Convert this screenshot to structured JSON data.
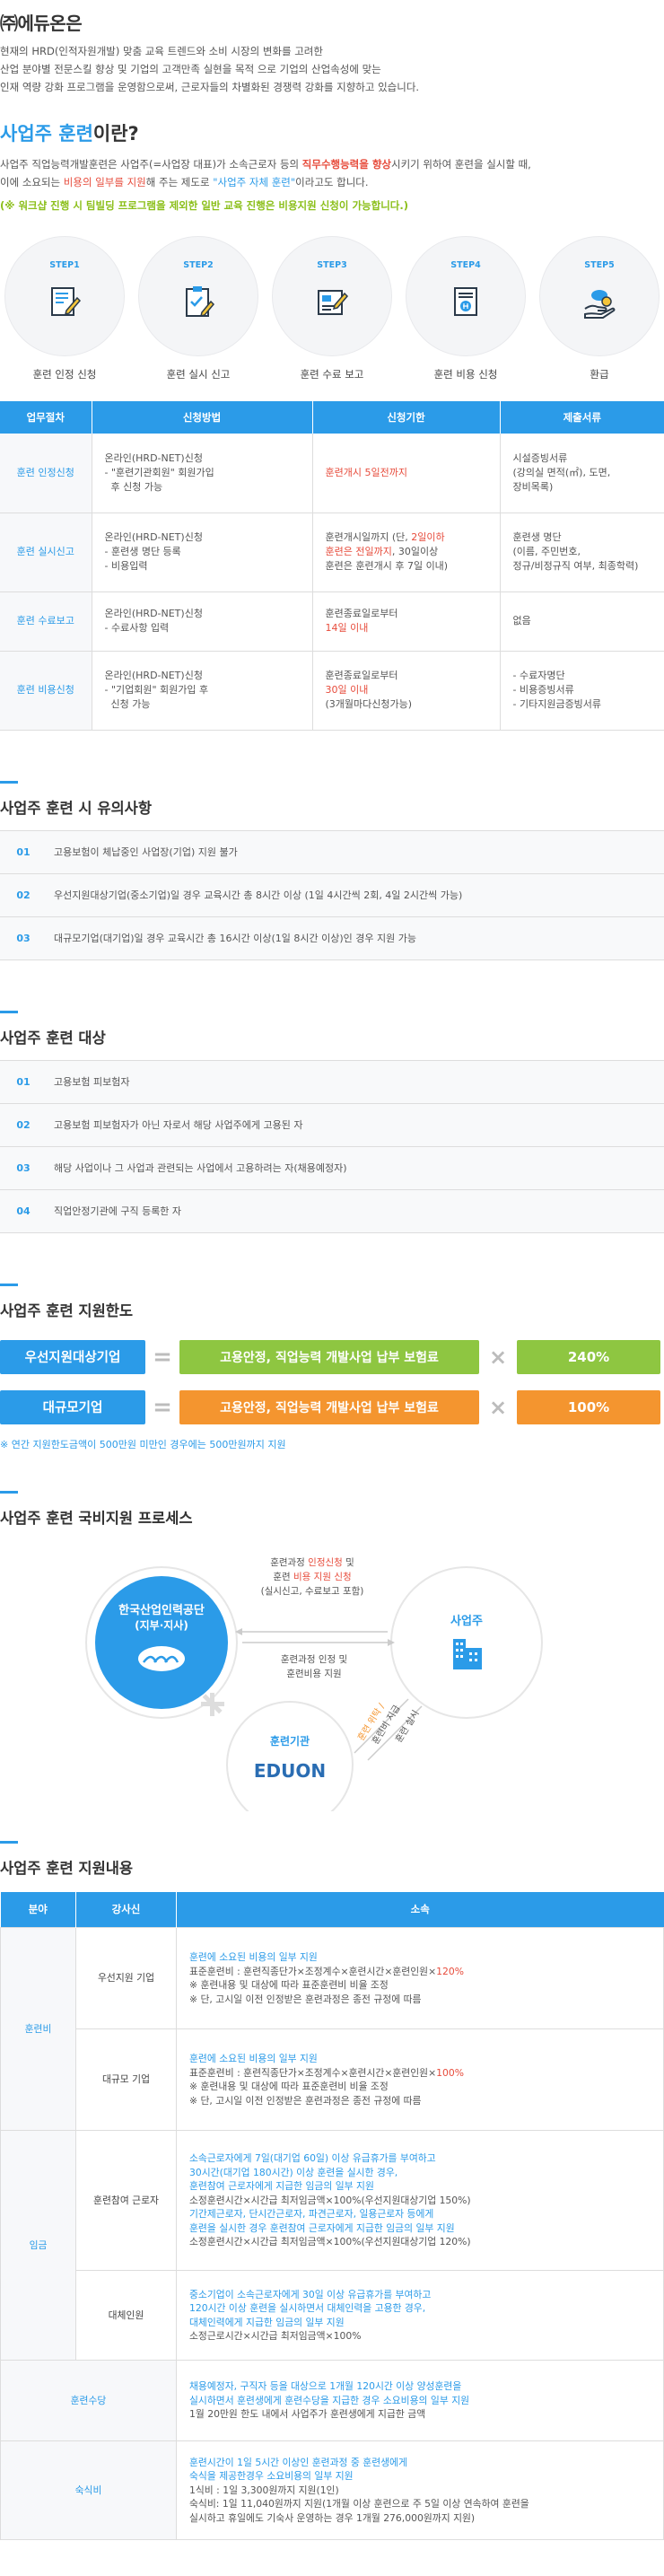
{
  "intro": {
    "title": "㈜에듀온은",
    "lines": [
      "현재의  HRD(인적자원개발) 맞춤 교육 트렌드와 소비 시장의 변화를 고려한",
      "산업 분야별 전문스킬 향상 및 기업의 고객만족  실현을  목적 으로 기업의 산업속성에 맞는",
      "인재 역량 강화 프로그램을 운영함으로써, 근로자들의 차별화된 경쟁력 강화를 지향하고 있습니다."
    ]
  },
  "what": {
    "title_a": "사업주 훈련",
    "title_b": "이란?",
    "l1a": "사업주 직업능력개발훈련은 사업주(=사업장 대표)가 소속근로자 등의 ",
    "l1b": "직무수행능력을 향상",
    "l1c": "시키기 위하여 훈련을 실시할 때,",
    "l2a": "이에 소요되는 ",
    "l2b": "비용의 일부를 지원",
    "l2c": "해 주는  제도로 ",
    "l2d": "\"사업주 자체 훈련\"",
    "l2e": "이라고도 합니다.",
    "note": "(※ 워크샵 진행 시 팀빌딩 프로그램을 제외한 일반 교육 진행은 비용지원 신청이 가능합니다.)"
  },
  "steps": [
    {
      "label": "STEP1",
      "name": "훈련 인정 신청",
      "icon": "application-form-icon"
    },
    {
      "label": "STEP2",
      "name": "훈련 실시 신고",
      "icon": "checklist-icon"
    },
    {
      "label": "STEP3",
      "name": "훈련 수료 보고",
      "icon": "report-edit-icon"
    },
    {
      "label": "STEP4",
      "name": "훈련 비용 신청",
      "icon": "cost-document-icon"
    },
    {
      "label": "STEP5",
      "name": "환급",
      "icon": "money-refund-icon"
    }
  ],
  "procedure": {
    "headers": [
      "업무절차",
      "신청방법",
      "신청기한",
      "제출서류"
    ],
    "rows": [
      {
        "name": "훈련 인정신청",
        "method": [
          "온라인(HRD-NET)신청",
          "- \"훈련기관회원\" 회원가입",
          "  후 신청 가능"
        ],
        "deadline": [
          {
            "t": "훈련개시 5일전까지",
            "red": true
          }
        ],
        "docs": [
          "시설증빙서류",
          "(강의실 면적(㎡), 도면,",
          "장비목록)"
        ]
      },
      {
        "name": "훈련 실시신고",
        "method": [
          "온라인(HRD-NET)신청",
          "- 훈련생 명단 등록",
          "- 비용입력"
        ],
        "deadline": [
          {
            "t": "훈련개시일까지 (단, ",
            "red": false,
            "t2": "2일이하",
            "t3": ""
          },
          {
            "t": "훈련은 전일까지",
            "red": true,
            "t2": ", 30일이상",
            "t3": ""
          },
          {
            "t": "훈련은 훈련개시 후 7일 이내)",
            "red": false
          }
        ],
        "docs": [
          "훈련생 명단",
          "(이름, 주민번호,",
          "정규/비정규직 여부, 최종학력)"
        ]
      },
      {
        "name": "훈련 수료보고",
        "method": [
          "온라인(HRD-NET)신청",
          "- 수료사항 입력"
        ],
        "deadline": [
          {
            "t": "훈련종료일로부터",
            "red": false
          },
          {
            "t": "14일 이내",
            "red": true
          }
        ],
        "docs": [
          "없음"
        ]
      },
      {
        "name": "훈련 비용신청",
        "method": [
          "온라인(HRD-NET)신청",
          "- \"기업회원\" 회원가입 후",
          "  신청 가능"
        ],
        "deadline": [
          {
            "t": "훈련종료일로부터",
            "red": false
          },
          {
            "t": "30일 이내",
            "red": true
          },
          {
            "t": "(3개월마다신청가능)",
            "red": false
          }
        ],
        "docs": [
          "- 수료자명단",
          "- 비용증빙서류",
          "- 기타지원금증빙서류"
        ]
      }
    ]
  },
  "cautions": {
    "title": "사업주 훈련 시 유의사항",
    "items": [
      {
        "num": "01",
        "text": "고용보험이 체납중인 사업장(기업) 지원 불가"
      },
      {
        "num": "02",
        "text": "우선지원대상기업(중소기업)일 경우 교육시간 총 8시간 이상 (1일 4시간씩 2회, 4일 2시간씩 가능)"
      },
      {
        "num": "03",
        "text": "대규모기업(대기업)일 경우 교육시간 총 16시간 이상(1일 8시간 이상)인 경우 지원 가능"
      }
    ]
  },
  "targets": {
    "title": "사업주 훈련 대상",
    "items": [
      {
        "num": "01",
        "text": "고용보험 피보험자"
      },
      {
        "num": "02",
        "text": "고용보험 피보험자가 아닌 자로서 해당 사업주에게 고용된 자"
      },
      {
        "num": "03",
        "text": "해당 사업이나 그 사업과 관련되는 사업에서 고용하려는 자(채용예정자)"
      },
      {
        "num": "04",
        "text": "직업안정기관에 구직 등록한 자"
      }
    ]
  },
  "limit": {
    "title": "사업주 훈련 지원한도",
    "rows": [
      {
        "left": "우선지원대상기업",
        "mid": "고용안정, 직업능력 개발사업 납부 보험료",
        "right": "240%",
        "color": "green"
      },
      {
        "left": "대규모기업",
        "mid": "고용안정, 직업능력 개발사업 납부 보험료",
        "right": "100%",
        "color": "orange"
      }
    ],
    "note": "※ 연간 지원한도금액이 500만원 미만인 경우에는 500만원까지 지원"
  },
  "process": {
    "title": "사업주 훈련 국비지원 프로세스",
    "agency_a": "한국산업인력공단",
    "agency_b": "(지부·지사)",
    "employer": "사업주",
    "institution": "훈련기관",
    "logo": "EDUON",
    "top1a": "훈련과정 ",
    "top1b": "인정신청",
    "top1c": " 및",
    "top2a": "훈련 ",
    "top2b": "비용 지원 신청",
    "top3": "(실시신고, 수료보고 포함)",
    "mid1": "훈련과정 인정  및",
    "mid2": "훈련비용 지원",
    "diag1": "훈련 위탁 /",
    "diag2": "훈련비 지급",
    "diag3": "훈련 실시"
  },
  "support": {
    "title": "사업주 훈련 지원내용",
    "headers": [
      "분야",
      "강사신",
      "소속"
    ],
    "cat_training": "훈련비",
    "cat_wage": "임금",
    "sub_priority": "우선지원 기업",
    "sub_large": "대규모 기업",
    "sub_participant": "훈련참여 근로자",
    "sub_substitute": "대체인원",
    "cat_allowance": "훈련수당",
    "cat_lodging": "숙식비",
    "priority": {
      "l1": "훈련에 소요된 비용의 일부 지원",
      "l2a": "표준훈련비 : 훈련직종단가×조정계수×훈련시간×훈련인원×",
      "l2b": "120%",
      "l3": "※ 훈련내용 및 대상에 따라 표준훈련비 비율 조정",
      "l4": "※ 단, 고시일 이전 인정받은 훈련과정은 종전 규정에 따름"
    },
    "large": {
      "l1": "훈련에 소요된 비용의 일부 지원",
      "l2a": "표준훈련비 : 훈련직종단가×조정계수×훈련시간×훈련인원×",
      "l2b": "100%",
      "l3": "※ 훈련내용 및 대상에 따라 표준훈련비 비율 조정",
      "l4": "※ 단, 고시일 이전 인정받은 훈련과정은 종전 규정에 따름"
    },
    "participant": {
      "b1": "소속근로자에게 7일(대기업 60일) 이상 유급휴가를 부여하고",
      "b2": "30시간(대기업 180시간) 이상 훈련을 실시한 경우,",
      "b3": "훈련참여 근로자에게 지급한 임금의 일부 지원",
      "g1": "소정훈련시간×시간급 최저임금액×100%(우선지원대상기업 150%)",
      "b4": "기간제근로자, 단시간근로자, 파견근로자, 일용근로자 등에게",
      "b5": "훈련을 실시한 경우 훈련참여 근로자에게 지급한 임금의 일부 지원",
      "g2": "소정훈련시간×시간급 최저임금액×100%(우선지원대상기업 120%)"
    },
    "substitute": {
      "b1": "중소기업이 소속근로자에게 30일 이상 유급휴가를 부여하고",
      "b2": "120시간 이상 훈련을 실시하면서 대체인력을 고용한 경우,",
      "b3": "대체인력에게 지급한 임금의 일부 지원",
      "g1": "소정근로시간×시간급 최저임금액×100%"
    },
    "allowance": {
      "b1": "채용예정자, 구직자 등을 대상으로 1개월 120시간 이상 양성훈련을",
      "b2": "실시하면서 훈련생에게 훈련수당을 지급한 경우 소요비용의 일부 지원",
      "g1": "1월 20만원 한도 내에서 사업주가 훈련생에게 지급한 금액"
    },
    "lodging": {
      "b1": "훈련시간이 1일 5시간 이상인 훈련과정 중 훈련생에게",
      "b2": "숙식을 제공한경우 소요비용의 일부 지원",
      "g1": "1식비 : 1일 3,300원까지 지원(1인)",
      "g2": "숙식비: 1일 11,040원까지 지원(1개월 이상 훈련으로 주 5일 이상 연속하여 훈련을",
      "g3": "실시하고 휴일에도 기숙사 운영하는 경우 1개월 276,000원까지 지원)"
    }
  }
}
